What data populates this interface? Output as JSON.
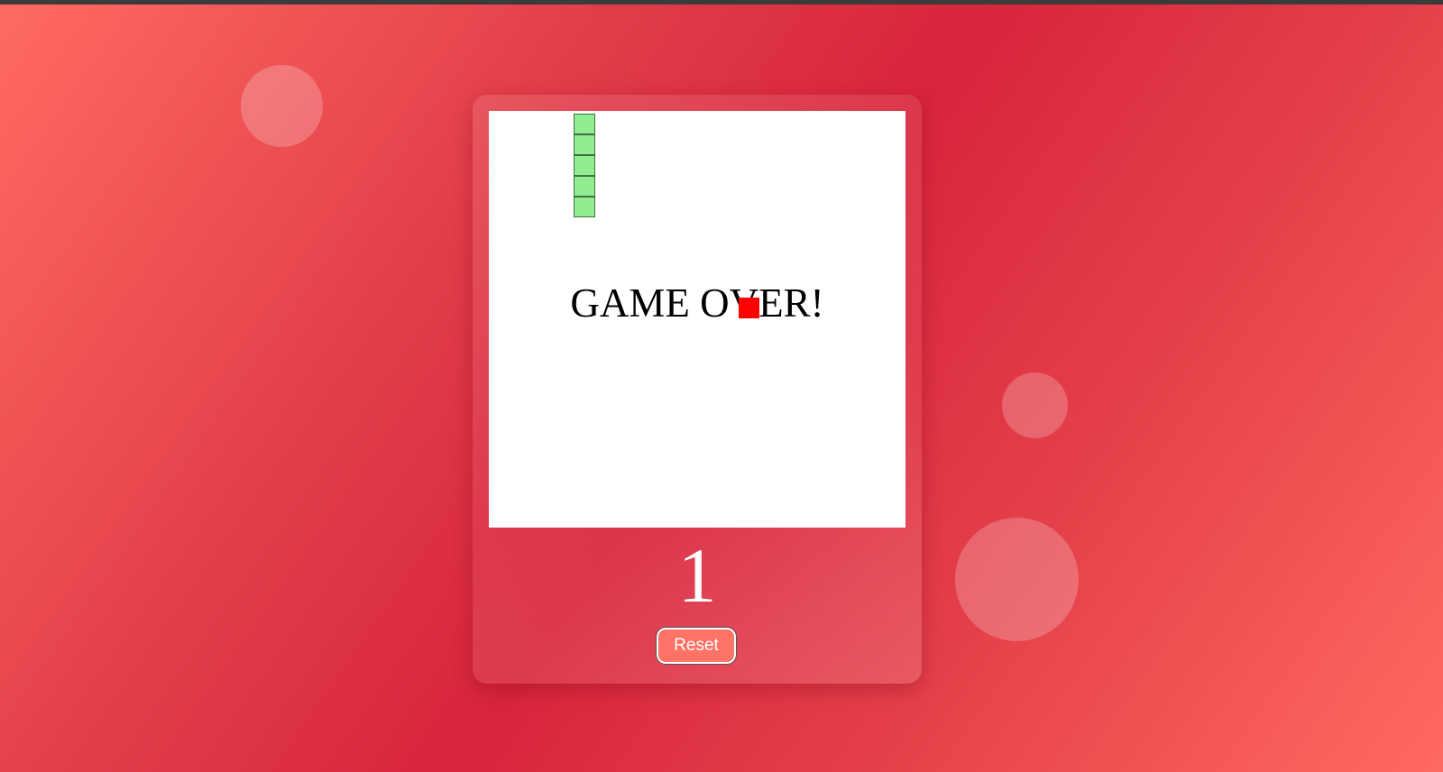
{
  "game": {
    "status_text": "GAME OVER!",
    "score": "1",
    "reset_label": "Reset"
  },
  "colors": {
    "snake": "#90ee90",
    "food": "#ff0000",
    "board": "#ffffff",
    "button": "#ff7366"
  }
}
